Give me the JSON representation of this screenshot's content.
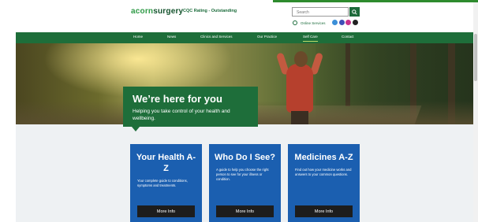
{
  "header": {
    "logo_acorn": "acorn",
    "logo_surgery": "surgery",
    "rating": "CQC Rating - Outstanding",
    "search_placeholder": "Search",
    "online_services": "Online Services",
    "social_icons": [
      "facebook-icon",
      "twitter-icon",
      "instagram-icon",
      "tiktok-icon"
    ]
  },
  "nav": {
    "items": [
      {
        "label": "Home"
      },
      {
        "label": "News"
      },
      {
        "label": "Clinics and Services"
      },
      {
        "label": "Our Practice"
      },
      {
        "label": "Self Care",
        "active": true
      },
      {
        "label": "Contact"
      }
    ]
  },
  "hero": {
    "title": "We’re here for you",
    "text": "Helping you take control of your health and wellbeing."
  },
  "cards": [
    {
      "title": "Your Health A-Z",
      "desc": "Your complete guide to conditions, symptoms and treatments.",
      "button": "More Info"
    },
    {
      "title": "Who Do I See?",
      "desc": "A guide to help you choose the right person to see for your illness or condition.",
      "button": "More Info"
    },
    {
      "title": "Medicines A-Z",
      "desc": "Find out how your medicine works and answers to your common questions.",
      "button": "More Info"
    }
  ],
  "colors": {
    "brand_green": "#1e6e3a",
    "card_blue": "#1b5fb0",
    "button_dark": "#1d1d1d"
  }
}
